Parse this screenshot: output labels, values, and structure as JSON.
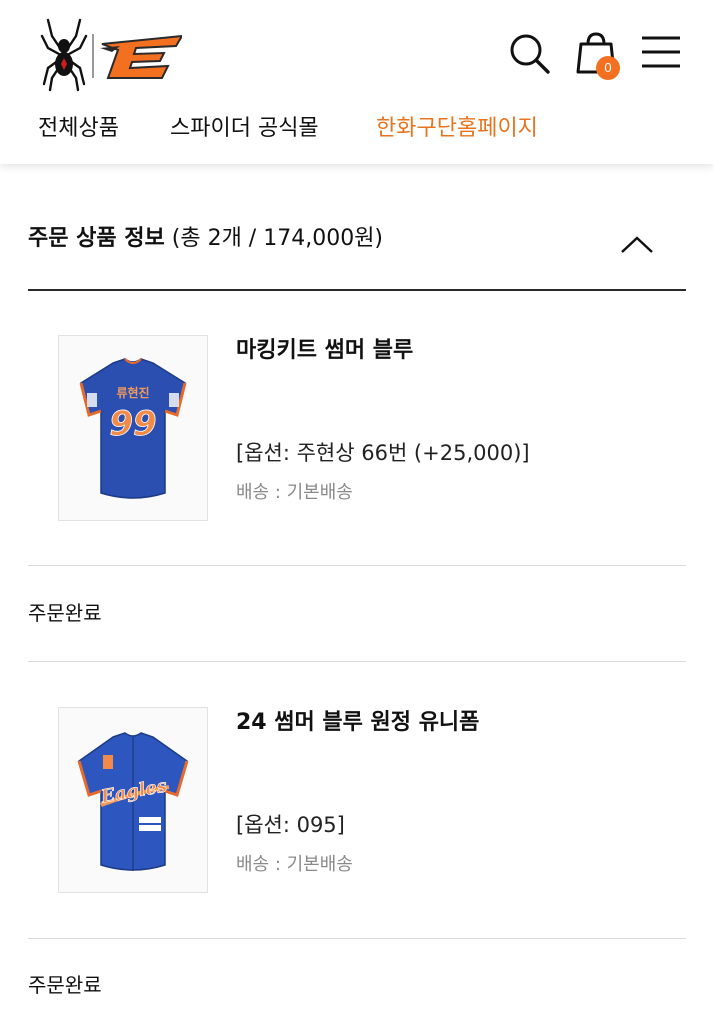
{
  "header": {
    "nav": [
      {
        "label": "전체상품",
        "active": false
      },
      {
        "label": "스파이더 공식몰",
        "active": false
      },
      {
        "label": "한화구단홈페이지",
        "active": true
      }
    ],
    "cart_count": "0",
    "icons": {
      "search": "search-icon",
      "cart": "shopping-bag-icon",
      "menu": "hamburger-menu-icon"
    },
    "accent_color": "#e8741f"
  },
  "order": {
    "title": "주문 상품 정보",
    "summary": "(총 2개 / 174,000원)",
    "items": [
      {
        "name": "마킹키트 썸머 블루",
        "option": "[옵션: 주현상 66번 (+25,000)]",
        "shipping": "배송 : 기본배송",
        "status": "주문완료",
        "jersey_text": "류현진",
        "jersey_number": "99"
      },
      {
        "name": "24 썸머 블루 원정 유니폼",
        "option": "[옵션: 095]",
        "shipping": "배송 : 기본배송",
        "status": "주문완료",
        "jersey_text": "Eagles"
      }
    ]
  }
}
